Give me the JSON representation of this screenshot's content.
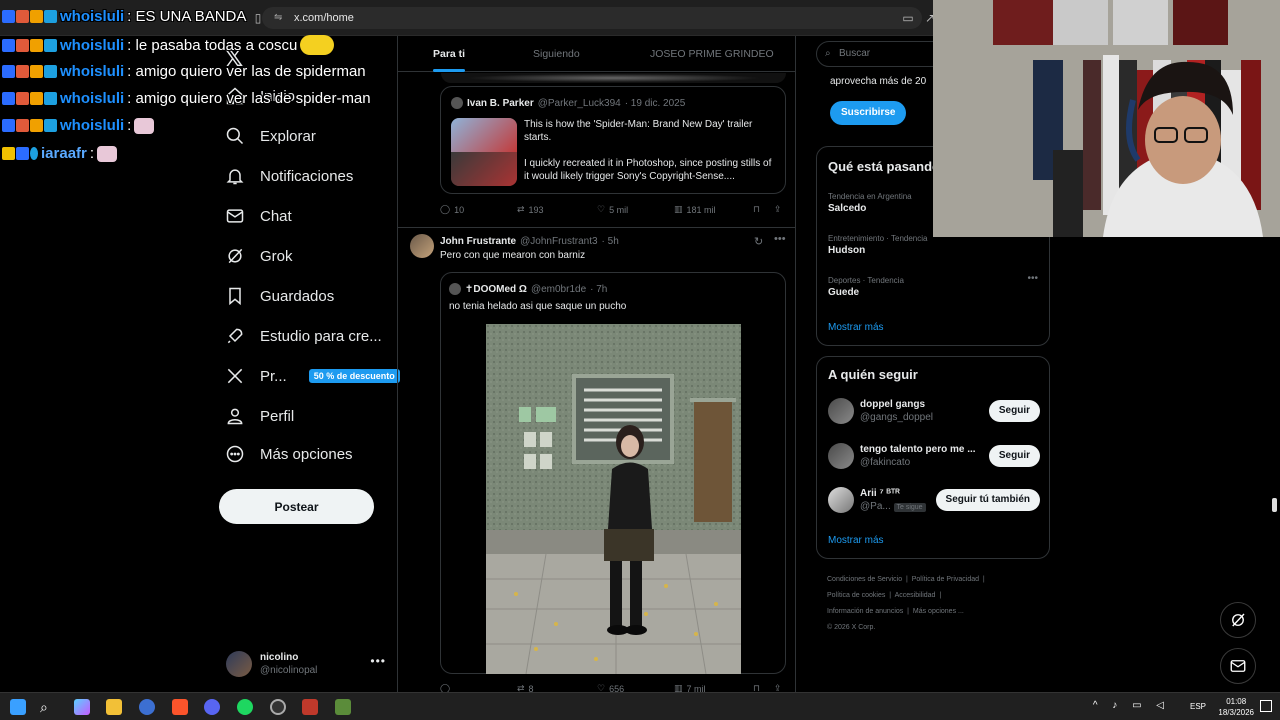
{
  "browser": {
    "url": "x.com/home"
  },
  "nav": {
    "items": [
      {
        "label": "Inicio",
        "icon": "home-icon"
      },
      {
        "label": "Explorar",
        "icon": "search-icon"
      },
      {
        "label": "Notificaciones",
        "icon": "bell-icon"
      },
      {
        "label": "Chat",
        "icon": "mail-icon"
      },
      {
        "label": "Grok",
        "icon": "grok-icon"
      },
      {
        "label": "Guardados",
        "icon": "bookmark-icon"
      },
      {
        "label": "Estudio para cre...",
        "icon": "rocket-icon"
      },
      {
        "label": "Pr...",
        "icon": "x-icon"
      },
      {
        "label": "Perfil",
        "icon": "person-icon"
      },
      {
        "label": "Más opciones",
        "icon": "more-circle-icon"
      }
    ],
    "premium_badge": "50 % de descuento",
    "post_button": "Postear",
    "profile": {
      "name": "nicolino",
      "handle": "@nicolinopal"
    }
  },
  "feed": {
    "tabs": [
      "Para ti",
      "Siguiendo",
      "JOSEO PRIME GRINDEO"
    ],
    "quote1": {
      "name": "Ivan B. Parker",
      "handle": "@Parker_Luck394",
      "date": "· 19 dic. 2025",
      "text1": "This is how the 'Spider-Man: Brand New Day' trailer starts.",
      "text2": "I quickly recreated it in Photoshop, since posting stills of it would likely trigger Sony's Copyright-Sense...."
    },
    "actions1": {
      "replies": "10",
      "reposts": "193",
      "likes": "5 mil",
      "views": "181 mil"
    },
    "tweet2": {
      "name": "John Frustrante",
      "handle": "@JohnFrustrant3",
      "time": "· 5h",
      "text": "Pero con que mearon con barniz"
    },
    "quote2": {
      "name": "✝DOOMed Ω",
      "handle": "@em0br1de",
      "time": "· 7h",
      "text": "no tenia helado asi que saque un pucho"
    },
    "actions2": {
      "replies": "",
      "reposts": "8",
      "likes": "656",
      "views": "7 mil"
    }
  },
  "right": {
    "search_placeholder": "Buscar",
    "premium_text": "aprovecha más de 20",
    "subscribe": "Suscribirse",
    "trends_title": "Qué está pasando",
    "trends": [
      {
        "context": "Tendencia en Argentina",
        "name": "Salcedo"
      },
      {
        "context": "Entretenimiento · Tendencia",
        "name": "Hudson"
      },
      {
        "context": "Deportes · Tendencia",
        "name": "Guede"
      }
    ],
    "trends_more": "Mostrar más",
    "follow_title": "A quién seguir",
    "follow": [
      {
        "name": "doppel gangs",
        "handle": "@gangs_doppel",
        "button": "Seguir"
      },
      {
        "name": "tengo talento pero me ...",
        "handle": "@fakincato",
        "button": "Seguir"
      },
      {
        "name": "Arii ⁷ ᴮᵀᴿ",
        "handle": "@Pa...",
        "badge": "Te sigue",
        "button": "Seguir tú también"
      }
    ],
    "follow_more": "Mostrar más",
    "footer": [
      "Condiciones de Servicio",
      "Política de Privacidad",
      "Política de cookies",
      "Accesibilidad",
      "Información de anuncios",
      "Más opciones ...",
      "© 2026 X Corp."
    ]
  },
  "chat": [
    {
      "user": "whoisluli",
      "msg": ": ES UNA BANDA"
    },
    {
      "user": "whoisluli",
      "msg": ": le pasaba todas a coscu"
    },
    {
      "user": "whoisluli",
      "msg": ": amigo quiero ver las de spiderman"
    },
    {
      "user": "whoisluli",
      "msg": ": amigo quiero ver las de spider-man"
    },
    {
      "user": "whoisluli",
      "msg": ":"
    },
    {
      "user": "iaraafr",
      "msg": ":"
    }
  ],
  "taskbar": {
    "lang": "ESP",
    "time": "01:08",
    "date": "18/3/2026"
  },
  "colors": {
    "accent": "#1d9bf0",
    "bg": "#000000",
    "border": "#2f3336",
    "chat_user": "#1e90ff"
  }
}
